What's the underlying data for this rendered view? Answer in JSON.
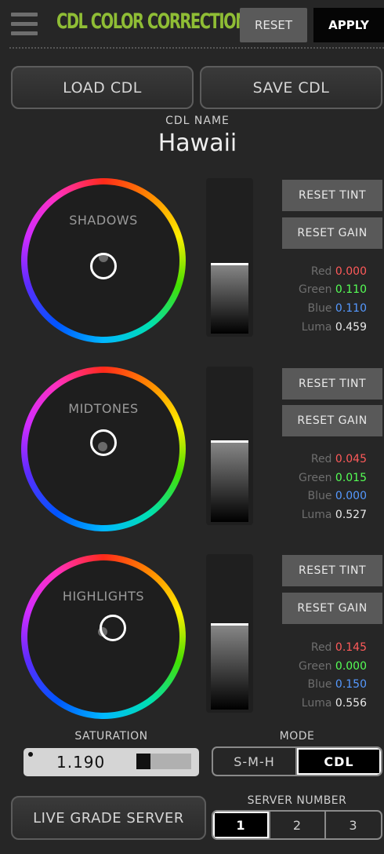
{
  "header": {
    "title": "CDL COLOR CORRECTION",
    "reset_label": "RESET",
    "apply_label": "APPLY"
  },
  "actions": {
    "load_label": "LOAD CDL",
    "save_label": "SAVE CDL"
  },
  "cdl": {
    "name_label": "CDL NAME",
    "name_value": "Hawaii"
  },
  "wheels": [
    {
      "label": "SHADOWS",
      "gain_level": 0.45,
      "reset_tint_label": "RESET TINT",
      "reset_gain_label": "RESET GAIN",
      "red_label": "Red",
      "red": "0.000",
      "green_label": "Green",
      "green": "0.110",
      "blue_label": "Blue",
      "blue": "0.110",
      "luma_label": "Luma",
      "luma": "0.459"
    },
    {
      "label": "MIDTONES",
      "gain_level": 0.5,
      "reset_tint_label": "RESET TINT",
      "reset_gain_label": "RESET GAIN",
      "red_label": "Red",
      "red": "0.045",
      "green_label": "Green",
      "green": "0.015",
      "blue_label": "Blue",
      "blue": "0.000",
      "luma_label": "Luma",
      "luma": "0.527"
    },
    {
      "label": "HIGHLIGHTS",
      "gain_level": 0.55,
      "reset_tint_label": "RESET TINT",
      "reset_gain_label": "RESET GAIN",
      "red_label": "Red",
      "red": "0.145",
      "green_label": "Green",
      "green": "0.000",
      "blue_label": "Blue",
      "blue": "0.150",
      "luma_label": "Luma",
      "luma": "0.556"
    }
  ],
  "saturation": {
    "label": "SATURATION",
    "value": "1.190"
  },
  "mode": {
    "label": "MODE",
    "options": [
      "S-M-H",
      "CDL"
    ],
    "selected": "CDL"
  },
  "live_grade": {
    "label": "LIVE GRADE SERVER"
  },
  "server": {
    "label": "SERVER NUMBER",
    "options": [
      "1",
      "2",
      "3"
    ],
    "selected": "1"
  },
  "colors": {
    "title": "#8fbd35",
    "red": "#ff5a5a",
    "green": "#55ff55",
    "blue": "#5599ff"
  }
}
